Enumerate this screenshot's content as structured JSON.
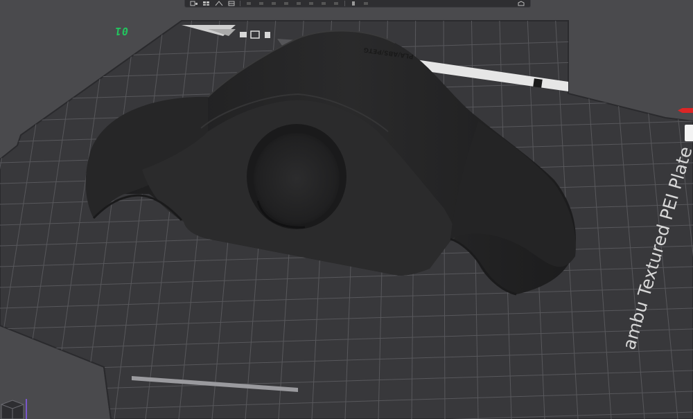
{
  "toolbar": {
    "items": [
      {
        "name": "add-object",
        "icon": "cube-add-icon"
      },
      {
        "name": "arrange",
        "icon": "grid-icon"
      },
      {
        "name": "orient",
        "icon": "orient-icon"
      },
      {
        "name": "layout",
        "icon": "layout-icon"
      },
      {
        "name": "move",
        "icon": "move-icon"
      },
      {
        "name": "rotate",
        "icon": "rotate-icon"
      },
      {
        "name": "scale",
        "icon": "scale-icon"
      },
      {
        "name": "cut",
        "icon": "cut-icon"
      },
      {
        "name": "paint",
        "icon": "paint-icon"
      },
      {
        "name": "support",
        "icon": "support-icon"
      },
      {
        "name": "seam",
        "icon": "seam-icon"
      },
      {
        "name": "text",
        "icon": "text-icon"
      },
      {
        "name": "measure",
        "icon": "measure-icon"
      },
      {
        "name": "assemble",
        "icon": "assemble-icon"
      },
      {
        "name": "view",
        "icon": "view-icon"
      }
    ]
  },
  "plate": {
    "index": "01",
    "name": "ambu Textured PEI Plate",
    "material": "PLA/ABS/PETG"
  },
  "colors": {
    "background": "#4a4a4d",
    "plate": "#38383b",
    "grid": "#58585c",
    "model": "#232324",
    "plate_index": "#22c55e",
    "axis_marker": "#dc2626"
  }
}
